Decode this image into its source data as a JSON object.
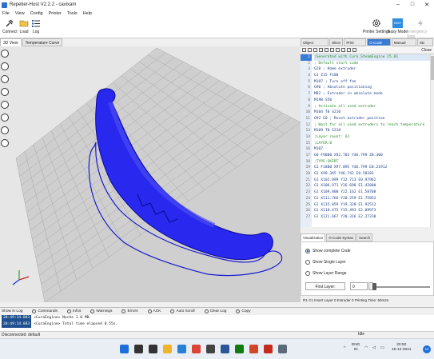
{
  "window": {
    "title": "Repetier-Host V2.2.2 - cavixam",
    "controls": [
      "–",
      "□",
      "✕"
    ]
  },
  "menu": [
    "File",
    "View",
    "Config",
    "Printer",
    "Tools",
    "Help"
  ],
  "toolbar": {
    "connect": "Connect",
    "load": "Load",
    "log": "Log",
    "printer_settings": "Printer Settings",
    "easy_mode": "Easy Mode",
    "easy_mode_badge": "EASY",
    "emergency_stop": "Emergency Stop"
  },
  "left_tabs": [
    "3D View",
    "Temperature Curve"
  ],
  "right_tabs": [
    "Object Placement",
    "Slicer",
    "Print Preview",
    "G-Code Editor",
    "Manual Control",
    "SD Card"
  ],
  "editor": {
    "close_label": "Close",
    "lines": [
      {
        "n": "1",
        "t": ";Generated with Cura_SteamEngine 15.01",
        "kind": "comment"
      },
      {
        "n": "2",
        "t": "; Default start code",
        "kind": "comment"
      },
      {
        "n": "3",
        "t": "G28 ; Home extruder",
        "kind": "code"
      },
      {
        "n": "4",
        "t": "G1 Z15 F100",
        "kind": "code"
      },
      {
        "n": "5",
        "t": "M107 ; Turn off fan",
        "kind": "code"
      },
      {
        "n": "6",
        "t": "G90 ; Absolute positioning",
        "kind": "code"
      },
      {
        "n": "7",
        "t": "M82 ; Extruder in absolute mode",
        "kind": "code"
      },
      {
        "n": "8",
        "t": "M190 S50",
        "kind": "code"
      },
      {
        "n": "9",
        "t": "; Activate all used extruder",
        "kind": "comment"
      },
      {
        "n": "10",
        "t": "M104 T0 S210",
        "kind": "code"
      },
      {
        "n": "11",
        "t": "G92 E0 ; Reset extruder position",
        "kind": "code"
      },
      {
        "n": "12",
        "t": "; Wait for all used extruders to reach temperature",
        "kind": "comment"
      },
      {
        "n": "13",
        "t": "M109 T0 S210",
        "kind": "code"
      },
      {
        "n": "14",
        "t": ";Layer count: 62",
        "kind": "comment"
      },
      {
        "n": "15",
        "t": ";LAYER:0",
        "kind": "comment"
      },
      {
        "n": "16",
        "t": "M107",
        "kind": "code"
      },
      {
        "n": "17",
        "t": "G0 F9000 X92.703 Y46.799 Z0.300",
        "kind": "code"
      },
      {
        "n": "18",
        "t": ";TYPE:SKIRT",
        "kind": "comment"
      },
      {
        "n": "19",
        "t": "G1 F1800 X97.095 Y46.799 E0.21912",
        "kind": "code"
      },
      {
        "n": "20",
        "t": "G1 X99.365 Y46.742 E0.58183",
        "kind": "code"
      },
      {
        "n": "21",
        "t": "G1 X102.099 Y32.713 E0.97962",
        "kind": "code"
      },
      {
        "n": "22",
        "t": "G1 X106.971 Y26.698 E1.42800",
        "kind": "code"
      },
      {
        "n": "23",
        "t": "G1 X109.800 Y22.162 E1.58788",
        "kind": "code"
      },
      {
        "n": "24",
        "t": "G1 X111.766 Y20.259 E1.75852",
        "kind": "code"
      },
      {
        "n": "25",
        "t": "G1 X115.059 Y19.328 E1.92512",
        "kind": "code"
      },
      {
        "n": "26",
        "t": "G1 X118.475 Y15.493 E2.09973",
        "kind": "code"
      },
      {
        "n": "27",
        "t": "G1 X121.667 Y20.316 E2.27230",
        "kind": "code"
      }
    ]
  },
  "sub_tabs": [
    "Visualization",
    "G-Code Syntax",
    "Search"
  ],
  "visualization": {
    "options": [
      "Show complete Code",
      "Show Single Layer",
      "Show Layer Range"
    ],
    "selected_index": 0,
    "first_layer_label": "First Layer:",
    "first_layer_value": "0",
    "slider_position": 0
  },
  "editor_status": "R1 C1 Insert Layer 0 Extruder 0 Printing Time: 50m2s",
  "log_toolbar": [
    "Show in Log",
    "Commands",
    "Infos",
    "Warnings",
    "Errors",
    "ACK",
    "Auto Scroll",
    "Clear Log",
    "Copy"
  ],
  "log": [
    {
      "ts": "20:49:14.883",
      "msg": "<CuraEngine> Noche   1.0 MB."
    },
    {
      "ts": "20:49:14.883",
      "msg": "<CuraEngine> Total time elapsed  0.55s."
    }
  ],
  "status": {
    "connection": "Disconnected: default",
    "state": "Idle"
  },
  "taskbar": {
    "lang": "ENG",
    "region": "IN",
    "time": "20:50",
    "date": "15-12-2021",
    "notifications": "11",
    "apps": [
      {
        "icon": "windows-start-icon",
        "color": "#1e6fd9"
      },
      {
        "icon": "search-icon",
        "color": "#333333"
      },
      {
        "icon": "task-view-icon",
        "color": "#333333"
      },
      {
        "icon": "file-explorer-icon",
        "color": "#f0b428"
      },
      {
        "icon": "edge-icon",
        "color": "#2a7fd6"
      },
      {
        "icon": "chrome-icon",
        "color": "#db4437"
      },
      {
        "icon": "store-icon",
        "color": "#444444"
      },
      {
        "icon": "word-icon",
        "color": "#2b579a"
      },
      {
        "icon": "xbox-icon",
        "color": "#107c10"
      },
      {
        "icon": "powerpoint-icon",
        "color": "#d24726"
      },
      {
        "icon": "weather-icon",
        "color": "#c42b1c"
      },
      {
        "icon": "repetier-icon",
        "color": "#5b6b7c"
      }
    ]
  },
  "colors": {
    "accent": "#1e6fd9",
    "model": "#2222e6",
    "grid": "#a0a0a0"
  }
}
